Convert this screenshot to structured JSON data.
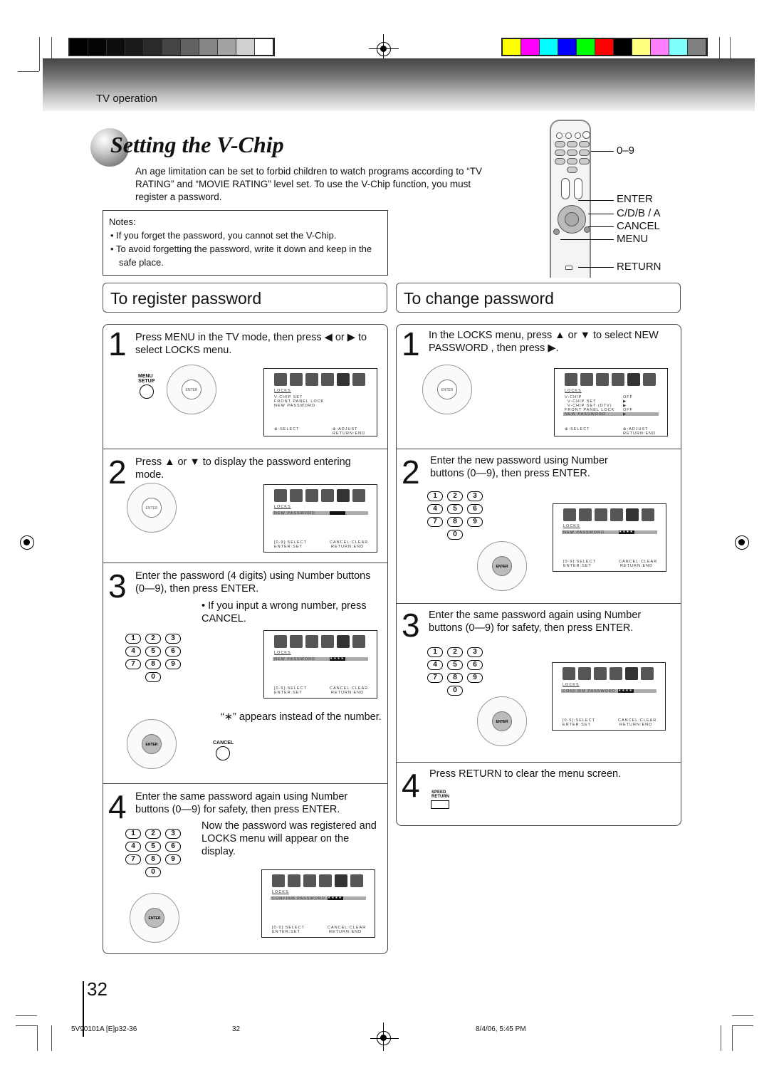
{
  "header": {
    "grayscale_swatches": [
      "#000000",
      "#050505",
      "#0d0d0d",
      "#1a1a1a",
      "#2a2a2a",
      "#444444",
      "#626262",
      "#868686",
      "#a3a3a3",
      "#d0d0d0",
      "#ffffff"
    ],
    "color_swatches": [
      "#ffff00",
      "#ff00ff",
      "#00ffff",
      "#0000ff",
      "#00ff00",
      "#ff0000",
      "#000000",
      "#ffff80",
      "#ff80ff",
      "#80ffff",
      "#808080"
    ],
    "section": "TV operation"
  },
  "title": "Setting the V-Chip",
  "intro": "An age limitation can be set to forbid children to watch programs according to “TV RATING” and “MOVIE RATING” level set. To use the V-Chip function, you must register a password.",
  "notes": {
    "heading": "Notes:",
    "items": [
      "If you forget the password, you cannot set the V-Chip.",
      "To avoid forgetting the password, write it down and keep in the safe place."
    ]
  },
  "remote_labels": {
    "digits": "0–9",
    "enter": "ENTER",
    "arrows": "C/D/B / A",
    "cancel": "CANCEL",
    "menu": "MENU",
    "return": "RETURN"
  },
  "register": {
    "heading": "To register password",
    "steps": [
      {
        "num": "1",
        "text": "Press MENU in the TV mode, then press ◀ or ▶ to select LOCKS menu.",
        "button_label": "MENU SETUP"
      },
      {
        "num": "2",
        "text": "Press ▲ or ▼ to display the password entering mode."
      },
      {
        "num": "3",
        "text": "Enter the password (4 digits) using Number buttons (0—9), then press ENTER.",
        "bullet": "If you input a wrong number, press CANCEL.",
        "note": "“∗” appears instead of the number.",
        "button_label": "CANCEL"
      },
      {
        "num": "4",
        "text": "Enter the same password again using Number buttons (0—9) for safety, then press ENTER.",
        "note": "Now the password was registered and LOCKS menu will appear on the display."
      }
    ]
  },
  "change": {
    "heading": "To change password",
    "steps": [
      {
        "num": "1",
        "text": "In the LOCKS menu, press ▲ or ▼ to select NEW PASSWORD , then press ▶."
      },
      {
        "num": "2",
        "text": "Enter the new password using Number buttons (0—9), then press ENTER."
      },
      {
        "num": "3",
        "text": "Enter the same password again using Number buttons (0—9) for safety, then press ENTER."
      },
      {
        "num": "4",
        "text": "Press RETURN to clear the menu screen.",
        "button_label": "SPEED RETURN"
      }
    ]
  },
  "osd": {
    "locks": "LOCKS",
    "menu1": [
      "V-CHIP SET",
      "FRONT PANEL LOCK",
      "NEW PASSWORD"
    ],
    "menu2_rows": [
      {
        "label": "V-CHIP",
        "value": "OFF"
      },
      {
        "label": "  V-CHIP SET",
        "value": "▶"
      },
      {
        "label": "  V-CHIP SET (DTV)",
        "value": "▶"
      },
      {
        "label": "FRONT PANEL LOCK",
        "value": "OFF"
      },
      {
        "label": "NEW PASSWORD",
        "value": "▶"
      }
    ],
    "new_password": "NEW PASSWORD",
    "confirm_password": "CONFIRM PASSWORD",
    "masked": "∗∗∗∗",
    "select": "⊕:SELECT",
    "adjust": "⊕:ADJUST",
    "return_end": "RETURN:END",
    "num_select": "[0-9]:SELECT",
    "enter_set": "ENTER:SET",
    "cancel_clear": "CANCEL:CLEAR",
    "enter_label": "ENTER"
  },
  "numpad": [
    "1",
    "2",
    "3",
    "4",
    "5",
    "6",
    "7",
    "8",
    "9",
    "0"
  ],
  "page_number": "32",
  "footer": {
    "file": "5V90101A [E]p32-36",
    "page": "32",
    "date": "8/4/06, 5:45 PM"
  }
}
